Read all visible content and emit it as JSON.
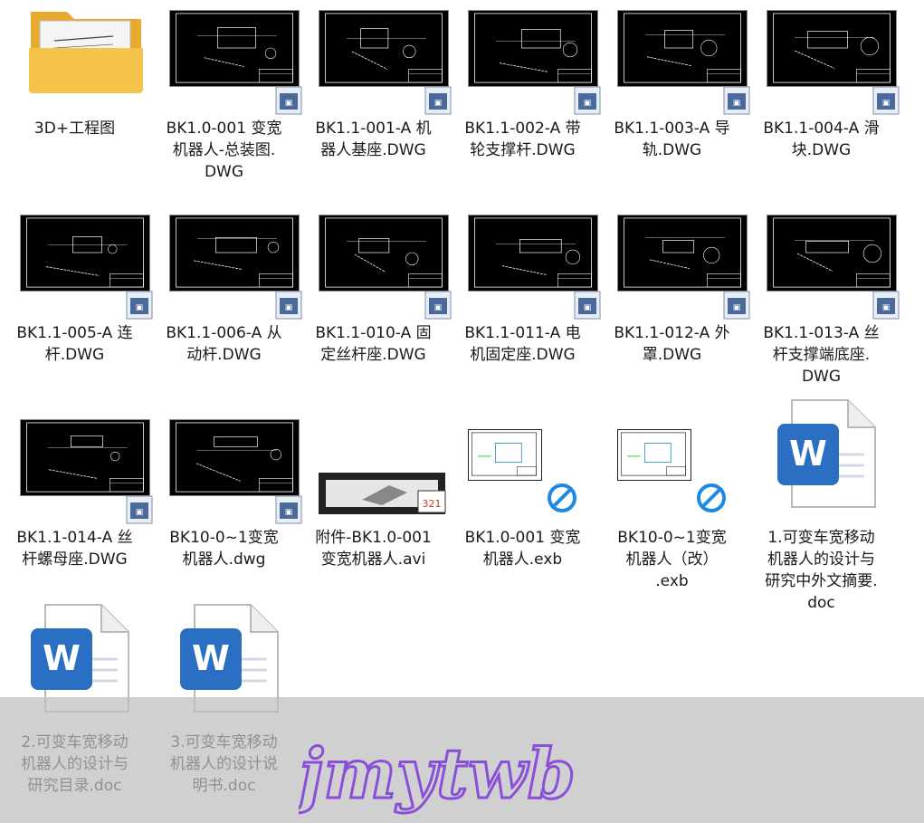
{
  "files": [
    {
      "name": "3D+工程图",
      "type": "folder"
    },
    {
      "name": "BK1.0-001 变宽\n机器人-总装图.\nDWG",
      "type": "dwg"
    },
    {
      "name": "BK1.1-001-A 机\n器人基座.DWG",
      "type": "dwg"
    },
    {
      "name": "BK1.1-002-A 带\n轮支撑杆.DWG",
      "type": "dwg"
    },
    {
      "name": "BK1.1-003-A 导\n轨.DWG",
      "type": "dwg"
    },
    {
      "name": "BK1.1-004-A 滑\n块.DWG",
      "type": "dwg"
    },
    {
      "name": "BK1.1-005-A 连\n杆.DWG",
      "type": "dwg"
    },
    {
      "name": "BK1.1-006-A 从\n动杆.DWG",
      "type": "dwg"
    },
    {
      "name": "BK1.1-010-A 固\n定丝杆座.DWG",
      "type": "dwg"
    },
    {
      "name": "BK1.1-011-A 电\n机固定座.DWG",
      "type": "dwg"
    },
    {
      "name": "BK1.1-012-A 外\n罩.DWG",
      "type": "dwg"
    },
    {
      "name": "BK1.1-013-A 丝\n杆支撑端底座.\nDWG",
      "type": "dwg"
    },
    {
      "name": "BK1.1-014-A 丝\n杆螺母座.DWG",
      "type": "dwg"
    },
    {
      "name": "BK10-0~1变宽\n机器人.dwg",
      "type": "dwg"
    },
    {
      "name": "附件-BK1.0-001\n变宽机器人.avi",
      "type": "avi"
    },
    {
      "name": "BK1.0-001 变宽\n机器人.exb",
      "type": "exb"
    },
    {
      "name": "BK10-0~1变宽\n机器人（改）\n.exb",
      "type": "exb"
    },
    {
      "name": "1.可变车宽移动\n机器人的设计与\n研究中外文摘要.\ndoc",
      "type": "doc"
    },
    {
      "name": "2.可变车宽移动\n机器人的设计与\n研究目录.doc",
      "type": "doc"
    },
    {
      "name": "3.可变车宽移动\n机器人的设计说\n明书.doc",
      "type": "doc"
    }
  ],
  "watermark": {
    "text": "jmytwb"
  },
  "icons": {
    "folder": "folder-icon",
    "dwg": "cad-drawing-thumbnail",
    "avi": "video-film-strip-icon",
    "exb": "exb-drawing-icon",
    "doc": "word-document-icon"
  },
  "colors": {
    "word_blue": "#2b6fc2",
    "folder_yellow": "#f6c34a",
    "watermark_purple": "#8a4fd8"
  }
}
